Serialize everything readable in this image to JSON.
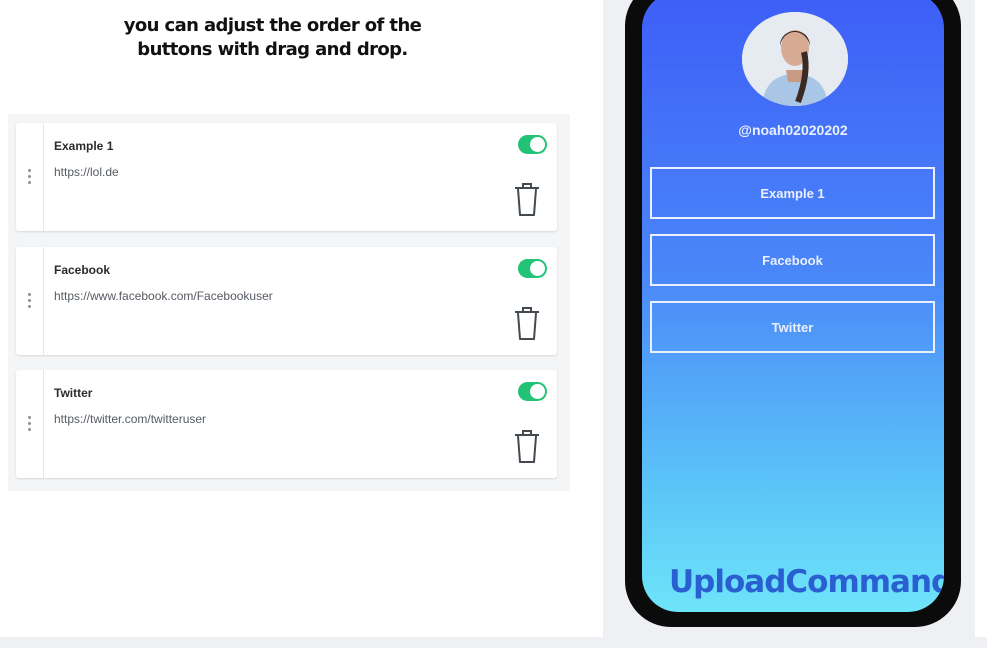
{
  "headline": {
    "line1": "you can adjust the order of the",
    "line2": "buttons with drag and drop."
  },
  "links": [
    {
      "title": "Example 1",
      "url": "https://lol.de",
      "enabled": true
    },
    {
      "title": "Facebook",
      "url": "https://www.facebook.com/Facebookuser",
      "enabled": true
    },
    {
      "title": "Twitter",
      "url": "https://twitter.com/twitteruser",
      "enabled": true
    }
  ],
  "preview": {
    "username": "@noah02020202",
    "buttons": [
      "Example 1",
      "Facebook",
      "Twitter"
    ],
    "logo_text": "UploadCommander"
  },
  "colors": {
    "toggle_on": "#22c277",
    "gradient_top": "#3d5ef7",
    "gradient_bottom": "#6ee4f9",
    "logo": "#2a5fd1"
  },
  "icons": [
    "drag-handle-icon",
    "toggle-switch",
    "trash-icon",
    "avatar-photo"
  ]
}
